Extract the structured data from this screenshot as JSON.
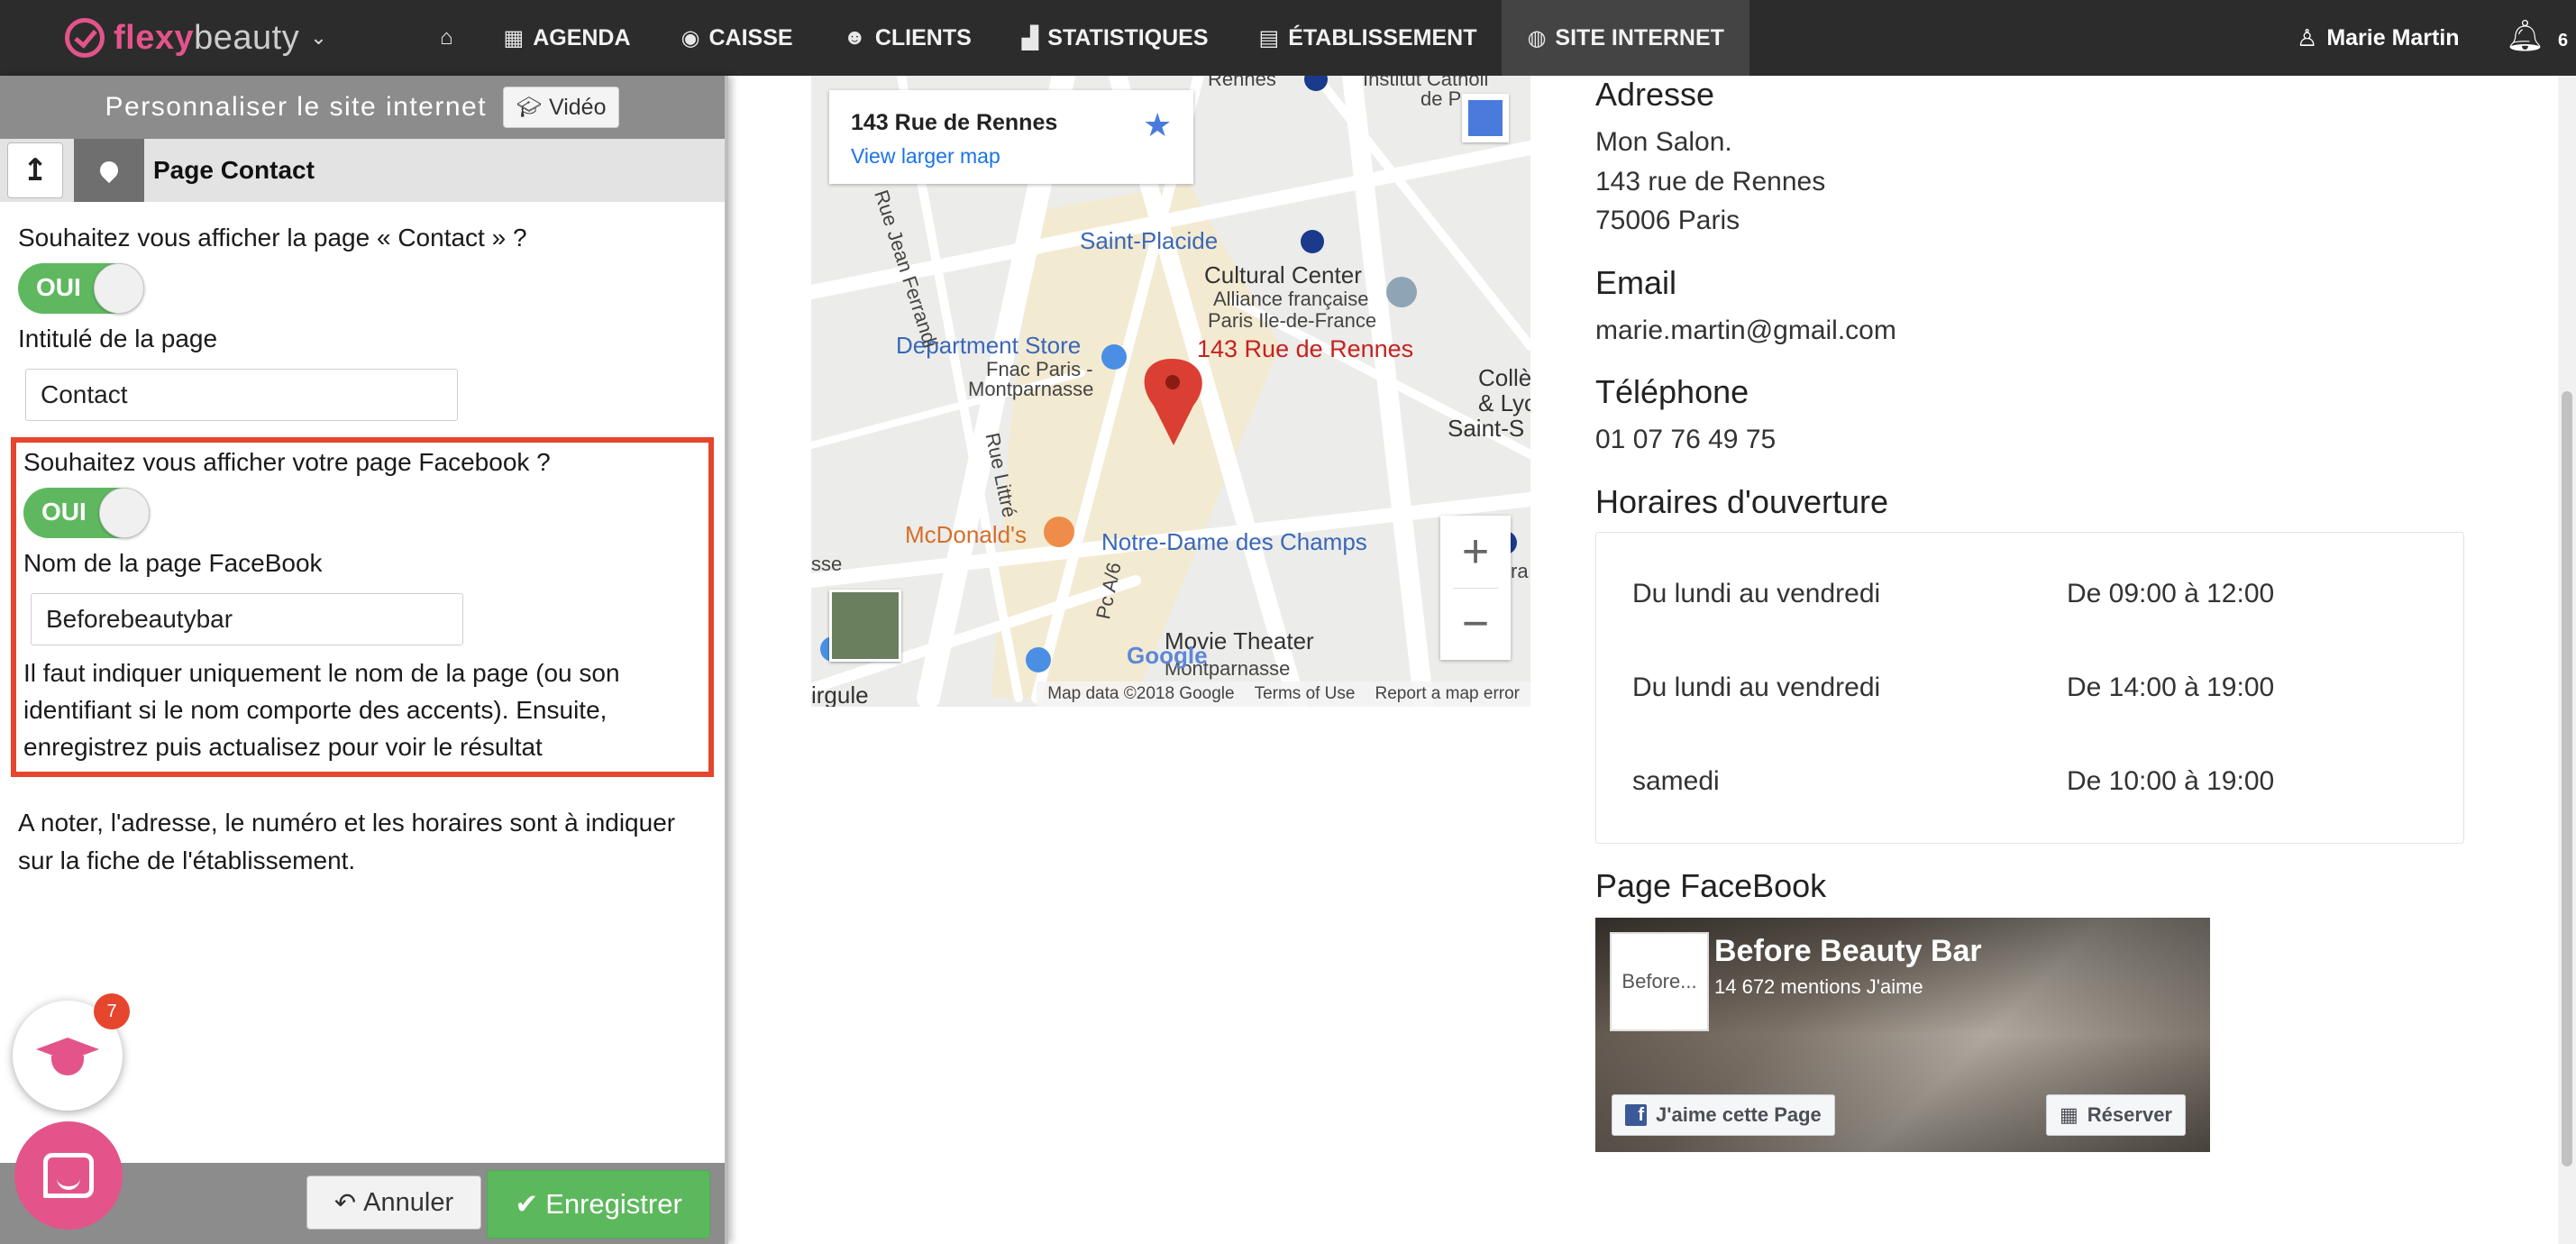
{
  "brand": {
    "name_bold": "flexy",
    "name_rest": "beauty",
    "accent_color": "#e3548b"
  },
  "nav": {
    "items": [
      {
        "label": "",
        "icon": "home-icon",
        "glyph": "⌂"
      },
      {
        "label": "AGENDA",
        "icon": "calendar-icon",
        "glyph": "▦"
      },
      {
        "label": "CAISSE",
        "icon": "coins-icon",
        "glyph": "◉"
      },
      {
        "label": "CLIENTS",
        "icon": "users-icon",
        "glyph": "👥"
      },
      {
        "label": "STATISTIQUES",
        "icon": "chart-icon",
        "glyph": "▟"
      },
      {
        "label": "ÉTABLISSEMENT",
        "icon": "store-icon",
        "glyph": "▤"
      },
      {
        "label": "SITE INTERNET",
        "icon": "globe-icon",
        "glyph": "◍"
      }
    ],
    "user": "Marie Martin",
    "notifications": "6"
  },
  "panel": {
    "title": "Personnaliser le site internet",
    "video_label": "Vidéo",
    "section_title": "Page Contact",
    "q_show_contact": "Souhaitez vous afficher la page « Contact » ?",
    "toggle_label": "OUI",
    "page_title_label": "Intitulé de la page",
    "page_title_value": "Contact",
    "q_show_facebook": "Souhaitez vous afficher votre page Facebook ?",
    "fb_name_label": "Nom de la page FaceBook",
    "fb_name_value": "Beforebeautybar",
    "hint": "Il faut indiquer uniquement le nom de la page (ou son identifiant si le nom comporte des accents). Ensuite, enregistrez puis actualisez pour voir le résultat",
    "note": "A noter, l'adresse, le numéro et les horaires sont à indiquer sur la fiche de l'établissement.",
    "cancel_label": "Annuler",
    "save_label": "Enregistrer",
    "help_badge": "7"
  },
  "map": {
    "card_title": "143 Rue de Rennes",
    "card_link": "View larger map",
    "labels": {
      "rennes": "Rennes",
      "institut": "Institut Catholi",
      "de_p": "de P",
      "saint_placide": "Saint-Placide",
      "cultural": "Cultural Center",
      "alliance": "Alliance française",
      "paris_idf": "Paris Ile-de-France",
      "dept_store": "Department Store",
      "fnac1": "Fnac Paris -",
      "fnac2": "Montparnasse",
      "pin_label": "143 Rue de Rennes",
      "mcdonalds": "McDonald's",
      "notre_dame": "Notre-Dame des Champs",
      "movie": "Movie Theater",
      "movie2": "Montparnasse",
      "rue_jean": "Rue Jean Ferrandi",
      "rue_littre": "Rue Littré",
      "pc_av": "Pc A/6",
      "colle": "Collè",
      "lyc": "& Lyc",
      "saint_s": "Saint-S",
      "irgule": "irgule",
      "sse": "sse",
      "ra": "ra"
    },
    "attrib": {
      "data": "Map data ©2018 Google",
      "terms": "Terms of Use",
      "report": "Report a map error"
    },
    "google": "Google"
  },
  "info": {
    "address_h": "Adresse",
    "address_lines": [
      "Mon Salon.",
      "143 rue de Rennes",
      "75006 Paris"
    ],
    "email_h": "Email",
    "email": "marie.martin@gmail.com",
    "phone_h": "Téléphone",
    "phone": "01 07 76 49 75",
    "hours_h": "Horaires d'ouverture",
    "hours": [
      {
        "day": "Du lundi au vendredi",
        "time": "De 09:00 à 12:00"
      },
      {
        "day": "Du lundi au vendredi",
        "time": "De 14:00 à 19:00"
      },
      {
        "day": "samedi",
        "time": "De 10:00 à 19:00"
      }
    ],
    "fb_h": "Page FaceBook",
    "fb_name": "Before Beauty Bar",
    "fb_likes": "14 672 mentions J'aime",
    "fb_logo": "Before...",
    "fb_like_btn": "J'aime cette Page",
    "fb_reserve_btn": "Réserver"
  }
}
